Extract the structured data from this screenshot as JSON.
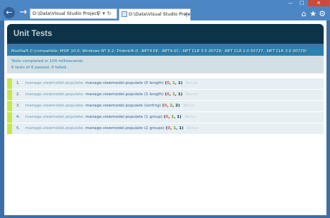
{
  "browser": {
    "address_value": "D:\\Data\\Visual Studio Project",
    "tab_title": "D:\\Data\\Visual Studio Proje...",
    "address_icons": [
      "search-icon",
      "refresh-icon"
    ],
    "toolbar_icons": [
      "home-icon",
      "star-icon",
      "gear-icon"
    ]
  },
  "page": {
    "header_title": "Unit Tests",
    "user_agent": "Mozilla/5.0 (compatible; MSIE 10.0; Windows NT 6.2; Trident/6.0; .NET4.0E; .NET4.0C; .NET CLR 3.5.30729; .NET CLR 2.0.50727; .NET CLR 3.0.30729)",
    "result_line1": "Tests completed in 104 milliseconds.",
    "result_line2": "6 tests of 6 passed, 0 failed.",
    "tests": [
      {
        "num": "1.",
        "module": "manage.viewmodel.populate:",
        "name": "manage.viewmodel.populate (0 length)",
        "failed": "0",
        "passed": "1",
        "total": "1",
        "rerun": "Rerun"
      },
      {
        "num": "2.",
        "module": "manage.viewmodel.populate:",
        "name": "manage.viewmodel.populate (1 length)",
        "failed": "0",
        "passed": "1",
        "total": "1",
        "rerun": "Rerun"
      },
      {
        "num": "3.",
        "module": "manage.viewmodel.populate:",
        "name": "manage.viewmodel.populate (sorting)",
        "failed": "0",
        "passed": "2",
        "total": "2",
        "rerun": "Rerun"
      },
      {
        "num": "4.",
        "module": "manage.viewmodel.populate:",
        "name": "manage.viewmodel.populate (1 group)",
        "failed": "0",
        "passed": "1",
        "total": "1",
        "rerun": "Rerun"
      },
      {
        "num": "5.",
        "module": "manage.viewmodel.populate:",
        "name": "manage.viewmodel.populate (2 groups)",
        "failed": "0",
        "passed": "1",
        "total": "1",
        "rerun": "Rerun"
      }
    ]
  },
  "colors": {
    "header_bg": "#0d3349",
    "banner_pass": "#3c76aa",
    "useragent_bg": "#2b81af",
    "testresult_bg": "#d2e0e6",
    "pass_marker": "#c6e746"
  }
}
